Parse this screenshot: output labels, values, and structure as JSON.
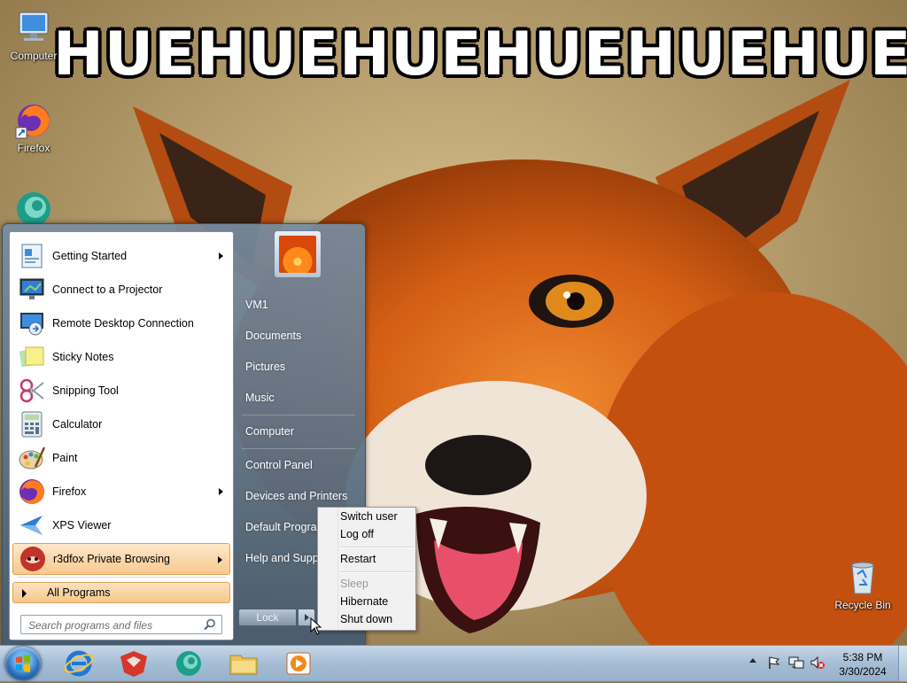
{
  "wallpaper": {
    "caption": "HUEHUEHUEHUEHUEHUE?"
  },
  "desktop": {
    "icons": [
      {
        "label": "Computer",
        "icon": "computer-icon"
      },
      {
        "label": "Firefox",
        "icon": "firefox-icon"
      },
      {
        "label": "",
        "icon": "r3dfox-icon"
      },
      {
        "label": "Recycle Bin",
        "icon": "recycle-bin-icon"
      }
    ]
  },
  "start_menu": {
    "programs": [
      {
        "label": "Getting Started",
        "icon": "getting-started-icon",
        "has_submenu": true
      },
      {
        "label": "Connect to a Projector",
        "icon": "projector-icon",
        "has_submenu": false
      },
      {
        "label": "Remote Desktop Connection",
        "icon": "remote-desktop-icon",
        "has_submenu": false
      },
      {
        "label": "Sticky Notes",
        "icon": "sticky-notes-icon",
        "has_submenu": false
      },
      {
        "label": "Snipping Tool",
        "icon": "scissors-icon",
        "has_submenu": false
      },
      {
        "label": "Calculator",
        "icon": "calculator-icon",
        "has_submenu": false
      },
      {
        "label": "Paint",
        "icon": "paint-palette-icon",
        "has_submenu": false
      },
      {
        "label": "Firefox",
        "icon": "firefox-icon",
        "has_submenu": true
      },
      {
        "label": "XPS Viewer",
        "icon": "xps-viewer-icon",
        "has_submenu": false
      },
      {
        "label": "r3dfox Private Browsing",
        "icon": "r3dfox-private-icon",
        "has_submenu": true,
        "highlighted": true
      }
    ],
    "all_programs_label": "All Programs",
    "search_placeholder": "Search programs and files",
    "right_items": {
      "user": "VM1",
      "documents": "Documents",
      "pictures": "Pictures",
      "music": "Music",
      "computer": "Computer",
      "control_panel": "Control Panel",
      "devices_printers": "Devices and Printers",
      "default_programs": "Default Programs",
      "help_support": "Help and Support"
    },
    "lock_label": "Lock"
  },
  "power_menu": {
    "switch_user": "Switch user",
    "log_off": "Log off",
    "restart": "Restart",
    "sleep": "Sleep",
    "hibernate": "Hibernate",
    "shut_down": "Shut down"
  },
  "taskbar": {
    "pinned": [
      "internet-explorer-icon",
      "r3dfox-icon",
      "r3dfox-alt-icon",
      "file-explorer-icon",
      "media-player-icon"
    ],
    "tray": {
      "time": "5:38 PM",
      "date": "3/30/2024"
    }
  },
  "colors": {
    "highlight": "#f8c890",
    "taskbar": "#a5bdd5",
    "start_pane": "#5d7389"
  }
}
